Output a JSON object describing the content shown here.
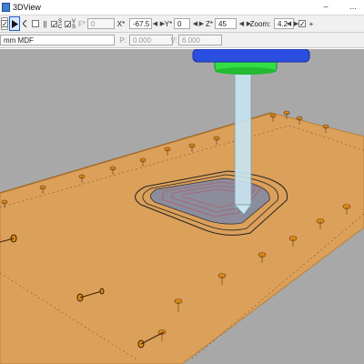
{
  "window": {
    "title": "3DView",
    "minimize_glyph": "–",
    "more_glyph": "..."
  },
  "toolbar": {
    "mode_checkbox": {
      "checked": true
    },
    "pause_symbol": "||",
    "s_label": "S",
    "c_label": "C",
    "v_label": "V",
    "s2_label": "S",
    "f_label": "F*",
    "f_value": "0",
    "x_label": "X*",
    "x_value": "-67.5",
    "y_label": "Y*",
    "y_value": "0",
    "z_label": "Z*",
    "z_value": "45",
    "zoom_label": "Zoom:",
    "zoom_value": "4.2",
    "plus_label": "+"
  },
  "material_bar": {
    "material_value": "mm MDF",
    "p_label": "P:",
    "p_value": "0.000",
    "v_label": "V:",
    "v_value": "6.000"
  },
  "viewport": {
    "colors": {
      "background": "#a8a8a8",
      "board": "#dba05a",
      "clamp": "#e08a18",
      "spindle_blue": "#2a4ee0",
      "spindle_green": "#33dd44",
      "tool": "#c8e6f2"
    }
  }
}
